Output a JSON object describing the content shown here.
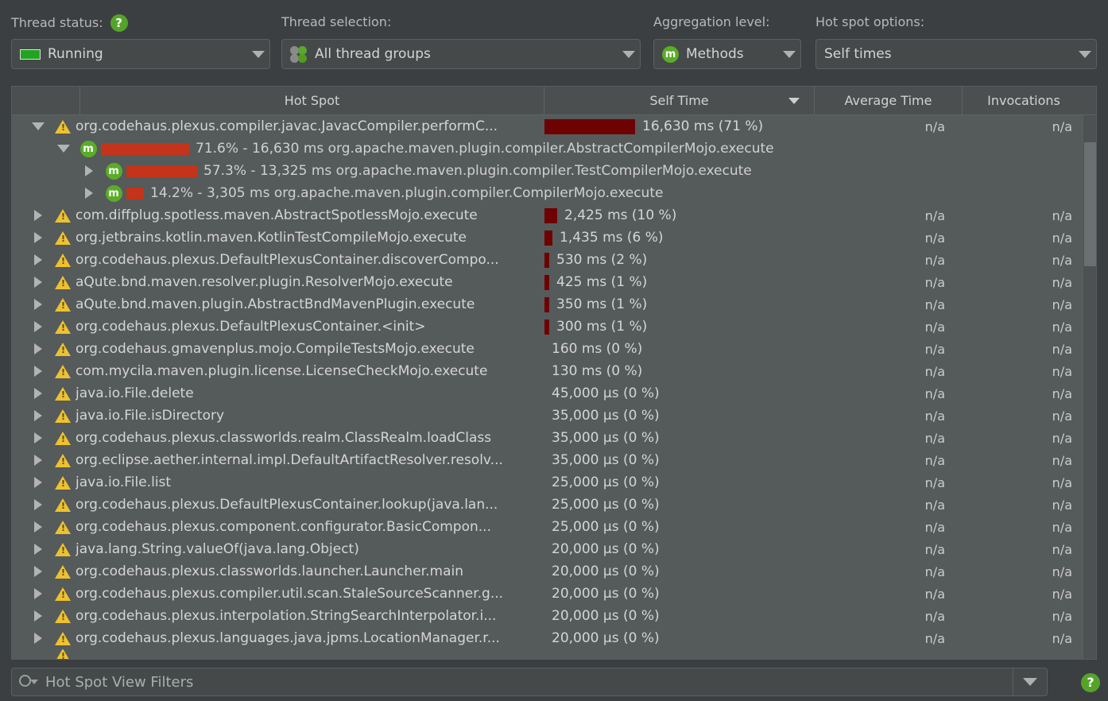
{
  "toolbar": {
    "thread_status": {
      "label": "Thread status:",
      "help_icon": "help-icon",
      "value": "Running",
      "status_color": "#21a521"
    },
    "thread_selection": {
      "label": "Thread selection:",
      "value": "All thread groups"
    },
    "aggregation_level": {
      "label": "Aggregation level:",
      "value": "Methods"
    },
    "hot_spot_options": {
      "label": "Hot spot options:",
      "value": "Self times"
    }
  },
  "table": {
    "columns": [
      {
        "key": "tree",
        "label": ""
      },
      {
        "key": "hotspot",
        "label": "Hot Spot"
      },
      {
        "key": "selftime",
        "label": "Self Time",
        "sorted": true,
        "sort_dir": "desc"
      },
      {
        "key": "avgtime",
        "label": "Average Time"
      },
      {
        "key": "invocations",
        "label": "Invocations"
      }
    ],
    "rows": [
      {
        "type": "hotspot",
        "expanded": true,
        "icon": "warning-icon",
        "name": "org.codehaus.plexus.compiler.javac.JavacCompiler.performC...",
        "bar_pct": 71,
        "self_time": "16,630 ms (71 %)",
        "average_time": "n/a",
        "invocations": "n/a"
      },
      {
        "type": "child",
        "depth": 1,
        "expanded": true,
        "icon": "method-icon",
        "bar_pct": 71.6,
        "text": "71.6% - 16,630 ms org.apache.maven.plugin.compiler.AbstractCompilerMojo.execute"
      },
      {
        "type": "child",
        "depth": 2,
        "expanded": false,
        "icon": "method-icon",
        "bar_pct": 57.3,
        "text": "57.3% - 13,325 ms org.apache.maven.plugin.compiler.TestCompilerMojo.execute"
      },
      {
        "type": "child",
        "depth": 2,
        "expanded": false,
        "icon": "method-icon",
        "bar_pct": 14.2,
        "text": "14.2% - 3,305 ms org.apache.maven.plugin.compiler.CompilerMojo.execute"
      },
      {
        "type": "hotspot",
        "expanded": false,
        "icon": "warning-icon",
        "name": "com.diffplug.spotless.maven.AbstractSpotlessMojo.execute",
        "bar_pct": 10,
        "self_time": "2,425 ms (10 %)",
        "average_time": "n/a",
        "invocations": "n/a"
      },
      {
        "type": "hotspot",
        "expanded": false,
        "icon": "warning-icon",
        "name": "org.jetbrains.kotlin.maven.KotlinTestCompileMojo.execute",
        "bar_pct": 6,
        "self_time": "1,435 ms (6 %)",
        "average_time": "n/a",
        "invocations": "n/a"
      },
      {
        "type": "hotspot",
        "expanded": false,
        "icon": "warning-icon",
        "name": "org.codehaus.plexus.DefaultPlexusContainer.discoverCompo...",
        "bar_pct": 2,
        "self_time": "530 ms (2 %)",
        "average_time": "n/a",
        "invocations": "n/a"
      },
      {
        "type": "hotspot",
        "expanded": false,
        "icon": "warning-icon",
        "name": "aQute.bnd.maven.resolver.plugin.ResolverMojo.execute",
        "bar_pct": 1.8,
        "self_time": "425 ms (1 %)",
        "average_time": "n/a",
        "invocations": "n/a"
      },
      {
        "type": "hotspot",
        "expanded": false,
        "icon": "warning-icon",
        "name": "aQute.bnd.maven.plugin.AbstractBndMavenPlugin.execute",
        "bar_pct": 1.5,
        "self_time": "350 ms (1 %)",
        "average_time": "n/a",
        "invocations": "n/a"
      },
      {
        "type": "hotspot",
        "expanded": false,
        "icon": "warning-icon",
        "name": "org.codehaus.plexus.DefaultPlexusContainer.<init>",
        "bar_pct": 1.3,
        "self_time": "300 ms (1 %)",
        "average_time": "n/a",
        "invocations": "n/a"
      },
      {
        "type": "hotspot",
        "expanded": false,
        "icon": "warning-icon",
        "name": "org.codehaus.gmavenplus.mojo.CompileTestsMojo.execute",
        "bar_pct": 0,
        "self_time": "160 ms (0 %)",
        "average_time": "n/a",
        "invocations": "n/a"
      },
      {
        "type": "hotspot",
        "expanded": false,
        "icon": "warning-icon",
        "name": "com.mycila.maven.plugin.license.LicenseCheckMojo.execute",
        "bar_pct": 0,
        "self_time": "130 ms (0 %)",
        "average_time": "n/a",
        "invocations": "n/a"
      },
      {
        "type": "hotspot",
        "expanded": false,
        "icon": "warning-icon",
        "name": "java.io.File.delete",
        "bar_pct": 0,
        "self_time": "45,000 µs (0 %)",
        "average_time": "n/a",
        "invocations": "n/a"
      },
      {
        "type": "hotspot",
        "expanded": false,
        "icon": "warning-icon",
        "name": "java.io.File.isDirectory",
        "bar_pct": 0,
        "self_time": "35,000 µs (0 %)",
        "average_time": "n/a",
        "invocations": "n/a"
      },
      {
        "type": "hotspot",
        "expanded": false,
        "icon": "warning-icon",
        "name": "org.codehaus.plexus.classworlds.realm.ClassRealm.loadClass",
        "bar_pct": 0,
        "self_time": "35,000 µs (0 %)",
        "average_time": "n/a",
        "invocations": "n/a"
      },
      {
        "type": "hotspot",
        "expanded": false,
        "icon": "warning-icon",
        "name": "org.eclipse.aether.internal.impl.DefaultArtifactResolver.resolv...",
        "bar_pct": 0,
        "self_time": "35,000 µs (0 %)",
        "average_time": "n/a",
        "invocations": "n/a"
      },
      {
        "type": "hotspot",
        "expanded": false,
        "icon": "warning-icon",
        "name": "java.io.File.list",
        "bar_pct": 0,
        "self_time": "25,000 µs (0 %)",
        "average_time": "n/a",
        "invocations": "n/a"
      },
      {
        "type": "hotspot",
        "expanded": false,
        "icon": "warning-icon",
        "name": "org.codehaus.plexus.DefaultPlexusContainer.lookup(java.lan...",
        "bar_pct": 0,
        "self_time": "25,000 µs (0 %)",
        "average_time": "n/a",
        "invocations": "n/a"
      },
      {
        "type": "hotspot",
        "expanded": false,
        "icon": "warning-icon",
        "name": "org.codehaus.plexus.component.configurator.BasicCompon...",
        "bar_pct": 0,
        "self_time": "25,000 µs (0 %)",
        "average_time": "n/a",
        "invocations": "n/a"
      },
      {
        "type": "hotspot",
        "expanded": false,
        "icon": "warning-icon",
        "name": "java.lang.String.valueOf(java.lang.Object)",
        "bar_pct": 0,
        "self_time": "20,000 µs (0 %)",
        "average_time": "n/a",
        "invocations": "n/a"
      },
      {
        "type": "hotspot",
        "expanded": false,
        "icon": "warning-icon",
        "name": "org.codehaus.plexus.classworlds.launcher.Launcher.main",
        "bar_pct": 0,
        "self_time": "20,000 µs (0 %)",
        "average_time": "n/a",
        "invocations": "n/a"
      },
      {
        "type": "hotspot",
        "expanded": false,
        "icon": "warning-icon",
        "name": "org.codehaus.plexus.compiler.util.scan.StaleSourceScanner.g...",
        "bar_pct": 0,
        "self_time": "20,000 µs (0 %)",
        "average_time": "n/a",
        "invocations": "n/a"
      },
      {
        "type": "hotspot",
        "expanded": false,
        "icon": "warning-icon",
        "name": "org.codehaus.plexus.interpolation.StringSearchInterpolator.i...",
        "bar_pct": 0,
        "self_time": "20,000 µs (0 %)",
        "average_time": "n/a",
        "invocations": "n/a"
      },
      {
        "type": "hotspot",
        "expanded": false,
        "icon": "warning-icon",
        "name": "org.codehaus.plexus.languages.java.jpms.LocationManager.r...",
        "bar_pct": 0,
        "self_time": "20,000 µs (0 %)",
        "average_time": "n/a",
        "invocations": "n/a"
      }
    ]
  },
  "filter": {
    "placeholder": "Hot Spot View Filters",
    "value": ""
  },
  "colors": {
    "background": "#3c3f41",
    "table_background": "#555a5b",
    "header_background": "#4b4f50",
    "accent_green": "#5aad28",
    "self_bar": "#6e0202",
    "call_bar": "#c3341a",
    "warning": "#edc131",
    "text": "#d5d5d5"
  }
}
